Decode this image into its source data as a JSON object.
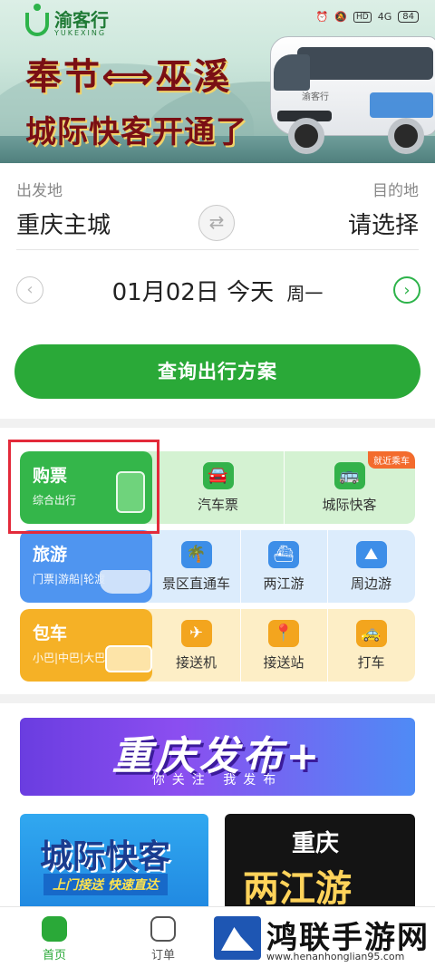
{
  "brand": {
    "name_cn": "渝客行",
    "name_en": "YUKEXING",
    "color": "#2aa938"
  },
  "status_bar": {
    "hd": "HD",
    "signal": "4G",
    "battery": "84"
  },
  "banner": {
    "line1": "奉节⟺巫溪",
    "line2": "城际快客开通了",
    "van_brand": "渝客行"
  },
  "trip": {
    "origin_label": "出发地",
    "destination_label": "目的地",
    "origin": "重庆主城",
    "destination": "请选择",
    "date": "01月02日",
    "day_label": "今天",
    "weekday": "周一",
    "query_button": "查询出行方案"
  },
  "services": {
    "ticket": {
      "title": "购票",
      "sub": "综合出行",
      "badge": "就近乘车",
      "items": [
        {
          "label": "汽车票",
          "icon": "car-icon"
        },
        {
          "label": "城际快客",
          "icon": "bus-icon"
        }
      ]
    },
    "travel": {
      "title": "旅游",
      "sub": "门票|游船|轮渡",
      "items": [
        {
          "label": "景区直通车",
          "icon": "scenic-car-icon"
        },
        {
          "label": "两江游",
          "icon": "ship-icon"
        },
        {
          "label": "周边游",
          "icon": "mountain-icon"
        }
      ]
    },
    "charter": {
      "title": "包车",
      "sub": "小巴|中巴|大巴",
      "items": [
        {
          "label": "接送机",
          "icon": "plane-icon"
        },
        {
          "label": "接送站",
          "icon": "station-icon"
        },
        {
          "label": "打车",
          "icon": "taxi-icon"
        }
      ]
    }
  },
  "promo": {
    "title": "重庆发布+",
    "subtitle": "你关注 我发布"
  },
  "cards": {
    "a_title": "城际快客",
    "a_sub": "上门接送 快速直达",
    "b_title1": "重庆",
    "b_title2": "两江游"
  },
  "tabbar": {
    "home": "首页",
    "orders": "订单"
  },
  "watermark": {
    "name": "鸿联手游网",
    "url": "www.henanhonglian95.com"
  }
}
